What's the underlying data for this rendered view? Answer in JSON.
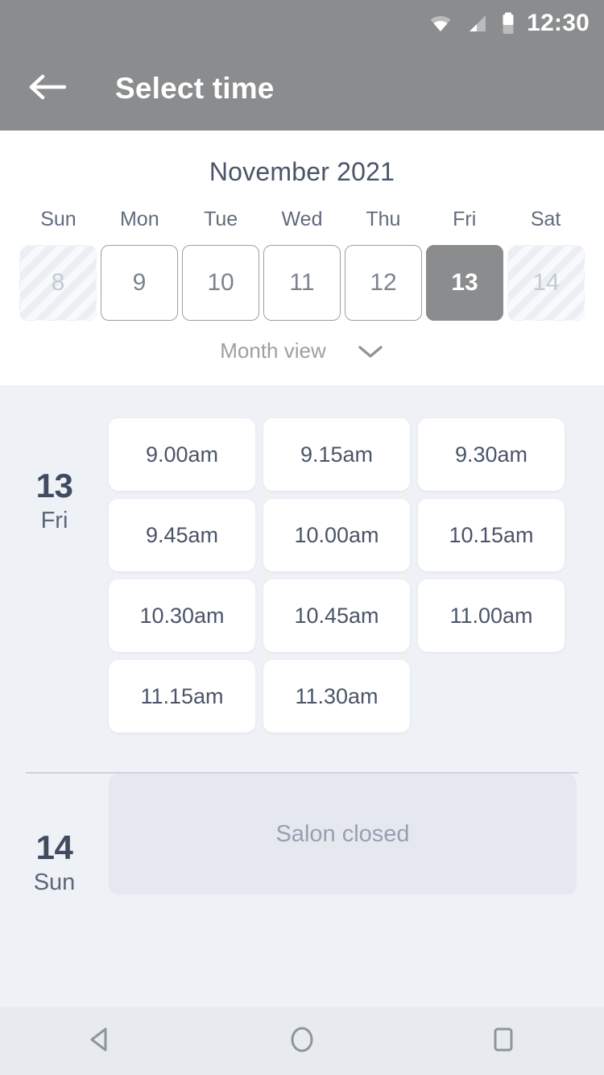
{
  "statusbar": {
    "time": "12:30",
    "icons": [
      "wifi-icon",
      "signal-icon",
      "battery-icon"
    ]
  },
  "appbar": {
    "title": "Select time",
    "back_icon": "arrow-left-icon"
  },
  "calendar": {
    "month_title": "November 2021",
    "weekdays": [
      "Sun",
      "Mon",
      "Tue",
      "Wed",
      "Thu",
      "Fri",
      "Sat"
    ],
    "days": [
      {
        "num": "8",
        "state": "disabled"
      },
      {
        "num": "9",
        "state": "normal"
      },
      {
        "num": "10",
        "state": "normal"
      },
      {
        "num": "11",
        "state": "normal"
      },
      {
        "num": "12",
        "state": "normal"
      },
      {
        "num": "13",
        "state": "selected"
      },
      {
        "num": "14",
        "state": "disabled"
      }
    ],
    "month_view_label": "Month view",
    "month_view_icon": "chevron-down-icon"
  },
  "schedule": [
    {
      "day_num": "13",
      "day_dow": "Fri",
      "closed": false,
      "closed_label": "",
      "slots": [
        "9.00am",
        "9.15am",
        "9.30am",
        "9.45am",
        "10.00am",
        "10.15am",
        "10.30am",
        "10.45am",
        "11.00am",
        "11.15am",
        "11.30am"
      ]
    },
    {
      "day_num": "14",
      "day_dow": "Sun",
      "closed": true,
      "closed_label": "Salon closed",
      "slots": []
    }
  ],
  "navbar": {
    "back": "nav-back-icon",
    "home": "nav-home-icon",
    "recents": "nav-recents-icon"
  },
  "colors": {
    "appbar_bg": "#8a8c8e",
    "panel_bg": "#ffffff",
    "slot_area_bg": "#eef1f6",
    "slot_bg": "#ffffff",
    "text_dark": "#4a5568",
    "text_muted": "#9aa0a6",
    "selected_bg": "#8a8c8e",
    "closed_bg": "#e5e9ef"
  }
}
